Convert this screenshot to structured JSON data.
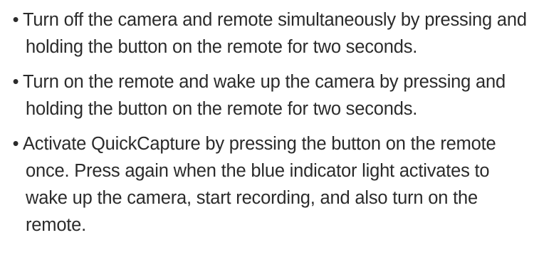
{
  "instructions": {
    "bullet_symbol": "•",
    "items": [
      {
        "text": "Turn off the camera and remote simultaneously by pressing and holding the button on the remote for two seconds."
      },
      {
        "text": "Turn on the remote and wake up the camera by pressing and holding the button on the remote for two seconds."
      },
      {
        "text": "Activate QuickCapture by pressing the button on the remote once. Press again when the blue indicator light activates to wake up the camera, start recording, and also turn on the remote."
      }
    ]
  }
}
